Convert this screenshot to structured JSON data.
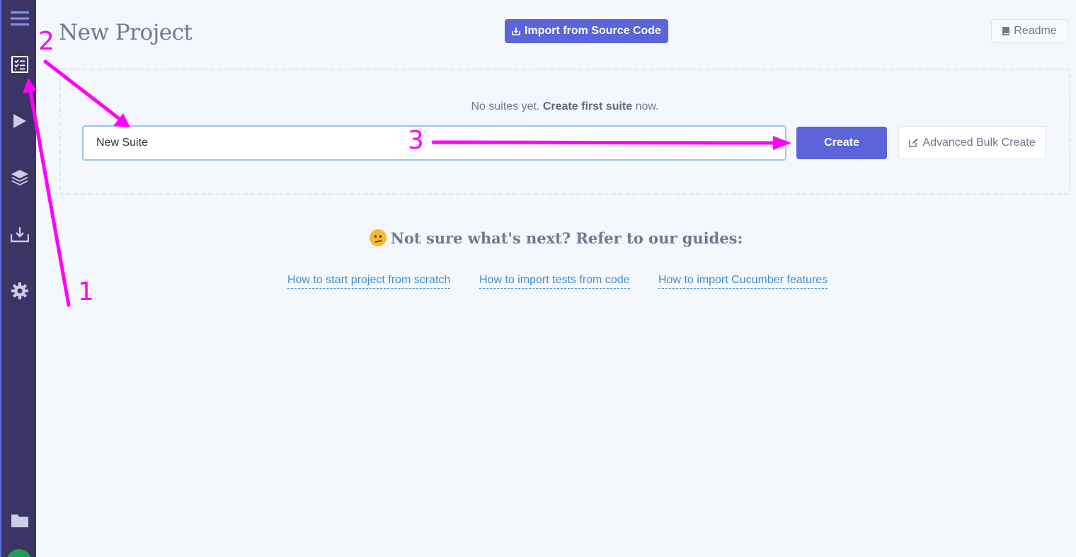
{
  "page": {
    "title": "New Project"
  },
  "sidebar": {
    "items": [
      {
        "icon": "menu-icon"
      },
      {
        "icon": "checklist-icon"
      },
      {
        "icon": "play-icon"
      },
      {
        "icon": "layers-icon"
      },
      {
        "icon": "download-tray-icon"
      },
      {
        "icon": "gear-icon"
      },
      {
        "icon": "folder-icon"
      }
    ]
  },
  "header": {
    "import_label": "Import from Source Code",
    "readme_label": "Readme"
  },
  "suites": {
    "empty_prefix": "No suites yet.",
    "empty_bold": "Create first suite",
    "empty_suffix": "now.",
    "input_value": "New Suite",
    "create_label": "Create",
    "bulk_label": "Advanced Bulk Create"
  },
  "guides": {
    "heading": "Not sure what's next? Refer to our guides:",
    "links": [
      "How to start project from scratch",
      "How to import tests from code",
      "How to import Cucumber features"
    ]
  },
  "annotations": {
    "labels": [
      "1",
      "2",
      "3"
    ],
    "color": "#ff00ff"
  },
  "colors": {
    "sidebar": "#3d3466",
    "primary": "#5b64d8",
    "link": "#3f8fd0"
  }
}
